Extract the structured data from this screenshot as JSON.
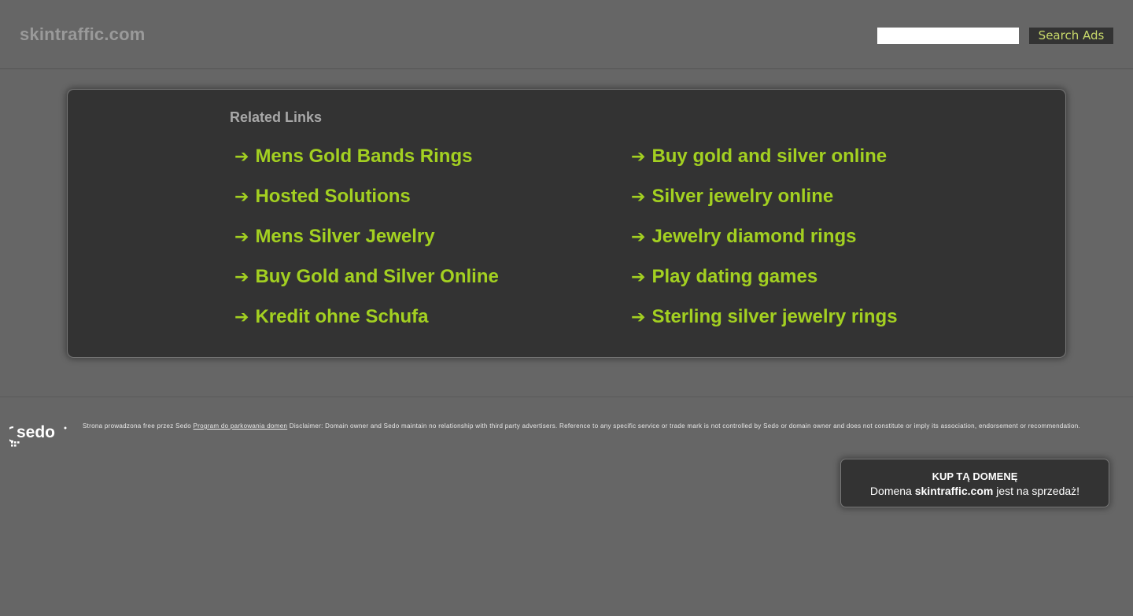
{
  "header": {
    "site_title": "skintraffic.com",
    "search_placeholder": "",
    "search_button_label": "Search Ads"
  },
  "related": {
    "heading": "Related Links",
    "arrow": "➔",
    "left_links": [
      "Mens Gold Bands Rings",
      "Hosted Solutions",
      "Mens Silver Jewelry",
      "Buy Gold and Silver Online",
      "Kredit ohne Schufa"
    ],
    "right_links": [
      "Buy gold and silver online",
      "Silver jewelry online",
      "Jewelry diamond rings",
      "Play dating games",
      "Sterling silver jewelry rings"
    ]
  },
  "footer": {
    "logo_text": "sedo",
    "disclaimer_prefix": "Strona prowadzona free przez Sedo",
    "disclaimer_link": "Program do parkowania domen",
    "disclaimer_text": "Disclaimer: Domain owner and Sedo maintain no relationship with third party advertisers. Reference to any specific service or trade mark is not controlled by Sedo or domain owner and does not constitute or imply its association, endorsement or recommendation."
  },
  "buy_box": {
    "title": "KUP TĄ DOMENĘ",
    "line_prefix": "Domena",
    "domain": "skintraffic.com",
    "line_suffix": "jest na sprzedaż!"
  },
  "colors": {
    "background": "#666666",
    "box": "#333333",
    "link": "#a3d021",
    "search_button_text": "#c8d96a"
  }
}
